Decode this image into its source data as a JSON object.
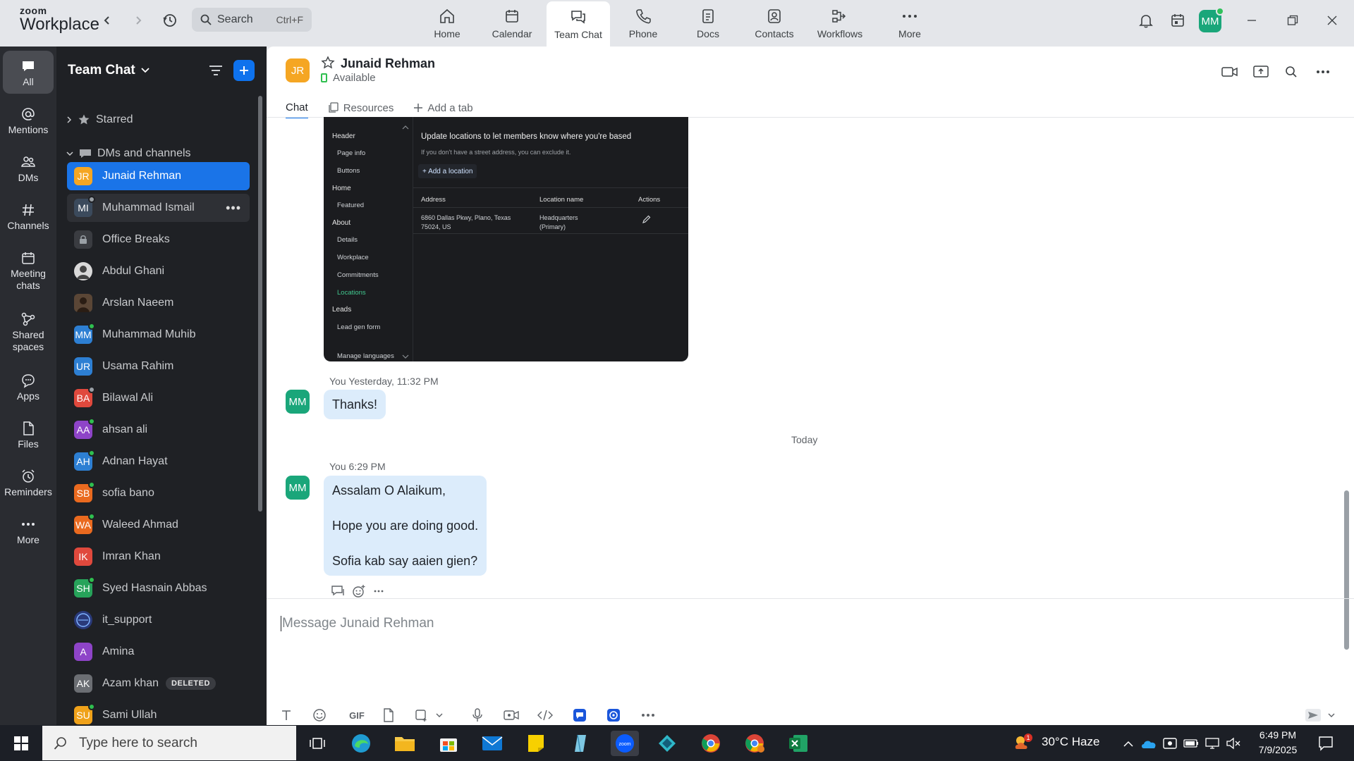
{
  "app": {
    "logo_line1": "zoom",
    "logo_line2": "Workplace"
  },
  "search": {
    "label": "Search",
    "shortcut": "Ctrl+F"
  },
  "topnav": [
    {
      "label": "Home"
    },
    {
      "label": "Calendar"
    },
    {
      "label": "Team Chat"
    },
    {
      "label": "Phone"
    },
    {
      "label": "Docs"
    },
    {
      "label": "Contacts"
    },
    {
      "label": "Workflows"
    },
    {
      "label": "More"
    }
  ],
  "user": {
    "initials": "MM"
  },
  "rail": [
    {
      "label": "All"
    },
    {
      "label": "Mentions"
    },
    {
      "label": "DMs"
    },
    {
      "label": "Channels"
    },
    {
      "label": "Meeting chats"
    },
    {
      "label": "Shared spaces"
    },
    {
      "label": "Apps"
    },
    {
      "label": "Files"
    },
    {
      "label": "Reminders"
    },
    {
      "label": "More"
    }
  ],
  "sidebar": {
    "title": "Team Chat",
    "starred": "Starred",
    "dms_section": "DMs and channels",
    "contacts": [
      {
        "initials": "JR",
        "name": "Junaid Rehman",
        "color": "#f5a623"
      },
      {
        "initials": "MI",
        "name": "Muhammad Ismail",
        "color": "#3b4a5c"
      },
      {
        "initials": "",
        "name": "Office Breaks",
        "color": "#3a3c41"
      },
      {
        "initials": "",
        "name": "Abdul Ghani",
        "color": "#8a8f96"
      },
      {
        "initials": "",
        "name": "Arslan Naeem",
        "color": "#5a4636"
      },
      {
        "initials": "MM",
        "name": "Muhammad Muhib",
        "color": "#2d7fd3"
      },
      {
        "initials": "UR",
        "name": "Usama Rahim",
        "color": "#2d7fd3"
      },
      {
        "initials": "BA",
        "name": "Bilawal Ali",
        "color": "#e0493d"
      },
      {
        "initials": "AA",
        "name": "ahsan ali",
        "color": "#8e44c8"
      },
      {
        "initials": "AH",
        "name": "Adnan Hayat",
        "color": "#2d7fd3"
      },
      {
        "initials": "SB",
        "name": "sofia bano",
        "color": "#ea6a1f"
      },
      {
        "initials": "WA",
        "name": "Waleed Ahmad",
        "color": "#ea6a1f"
      },
      {
        "initials": "IK",
        "name": "Imran Khan",
        "color": "#e0493d"
      },
      {
        "initials": "SH",
        "name": "Syed Hasnain Abbas",
        "color": "#27a35a"
      },
      {
        "initials": "",
        "name": "it_support",
        "color": "#2a3a7a"
      },
      {
        "initials": "A",
        "name": "Amina",
        "color": "#8e44c8"
      },
      {
        "initials": "AK",
        "name": "Azam khan",
        "color": "#6b6e73",
        "badge": "DELETED"
      },
      {
        "initials": "SU",
        "name": "Sami Ullah",
        "color": "#f0a21a"
      }
    ]
  },
  "chat": {
    "contact_initials": "JR",
    "contact_name": "Junaid Rehman",
    "status": "Available",
    "tabs": {
      "chat": "Chat",
      "resources": "Resources",
      "add": "Add a tab"
    },
    "screenshot": {
      "menu": [
        {
          "label": "Header",
          "sub": false
        },
        {
          "label": "Page info",
          "sub": true
        },
        {
          "label": "Buttons",
          "sub": true
        },
        {
          "label": "Home",
          "sub": false
        },
        {
          "label": "Featured",
          "sub": true
        },
        {
          "label": "About",
          "sub": false
        },
        {
          "label": "Details",
          "sub": true
        },
        {
          "label": "Workplace",
          "sub": true
        },
        {
          "label": "Commitments",
          "sub": true
        },
        {
          "label": "Locations",
          "sub": true,
          "highlight": true
        },
        {
          "label": "Leads",
          "sub": false
        },
        {
          "label": "Lead gen form",
          "sub": true
        },
        {
          "label": "Manage languages",
          "sub": true
        }
      ],
      "title": "Update locations to let members know where you're based",
      "subtitle": "If you don't have a street address, you can exclude it.",
      "add_button": "+ Add a location",
      "columns": [
        "Address",
        "Location name",
        "Actions"
      ],
      "row": {
        "address_line1": "6860 Dallas Pkwy, Plano, Texas",
        "address_line2": "75024, US",
        "name_line1": "Headquarters",
        "name_line2": "(Primary)"
      }
    },
    "messages": [
      {
        "initials": "MM",
        "sender": "You",
        "time": "Yesterday, 11:32 PM",
        "lines": [
          "Thanks!"
        ]
      },
      {
        "initials": "MM",
        "sender": "You",
        "time": "6:29 PM",
        "lines": [
          "Assalam O Alaikum,",
          "Hope you are doing good.",
          "Sofia kab say aaien gien?"
        ]
      }
    ],
    "day_separator": "Today",
    "composer_placeholder": "Message Junaid Rehman",
    "gif_label": "GIF"
  },
  "taskbar": {
    "search_placeholder": "Type here to search",
    "weather": "30°C  Haze",
    "weather_badge": "1",
    "time": "6:49 PM",
    "date": "7/9/2025"
  }
}
